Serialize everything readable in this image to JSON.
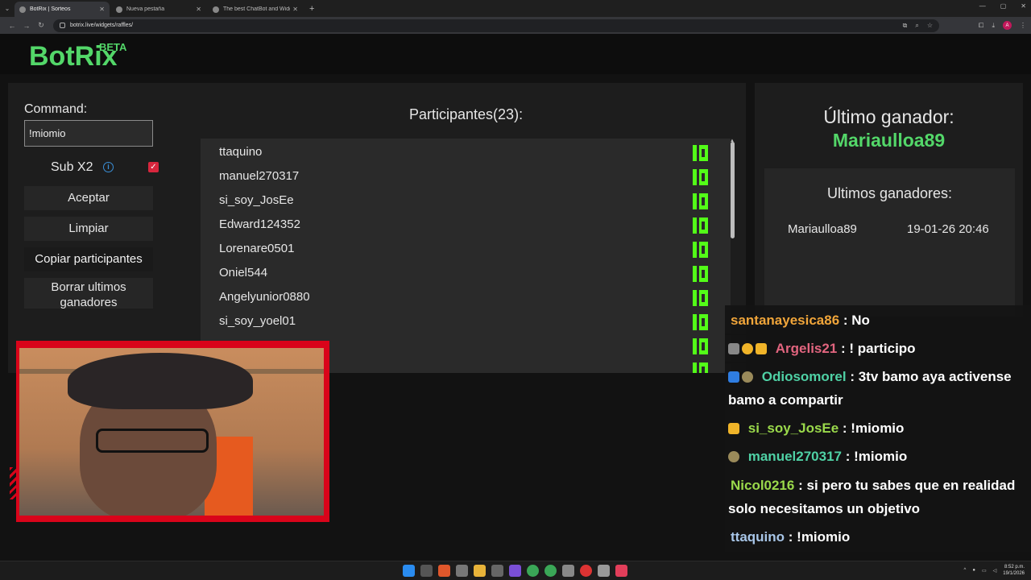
{
  "browser": {
    "tabs": [
      {
        "title": "BotRix | Sorteos",
        "active": true
      },
      {
        "title": "Nueva pestaña",
        "active": false
      },
      {
        "title": "The best ChatBot and Widgets",
        "active": false
      }
    ],
    "new_tab": "+",
    "url": "botrix.live/widgets/raffles/",
    "profile_initial": "A"
  },
  "header": {
    "logo": "BotRix",
    "badge": "BETA"
  },
  "controls": {
    "command_label": "Command:",
    "command_value": "!miomio",
    "sub_label": "Sub X2",
    "info_icon": "i",
    "sub_checked": "✓",
    "accept": "Aceptar",
    "clear": "Limpiar",
    "copy": "Copiar participantes",
    "delete": "Borrar ultimos ganadores"
  },
  "participants": {
    "title": "Participantes(23):",
    "list": [
      "ttaquino",
      "manuel270317",
      "si_soy_JosEe",
      "Edward124352",
      "Lorenare0501",
      "Oniel544",
      "Angelyunior0880",
      "si_soy_yoel01"
    ]
  },
  "winners": {
    "last_title": "Último ganador:",
    "last_name": "Mariaulloa89",
    "recent_title": "Ultimos ganadores:",
    "recent": [
      {
        "name": "Mariaulloa89",
        "date": "19-01-26 20:46"
      }
    ]
  },
  "chat": [
    {
      "user": "santanayesica86",
      "color": "#f0a53a",
      "text": " : No"
    },
    {
      "user": "Argelis21",
      "color": "#e2657f",
      "text": " : ! participo"
    },
    {
      "user": "Odiosomorel",
      "color": "#4fd1a5",
      "text": " : 3tv bamo aya activense bamo a compartir"
    },
    {
      "user": "si_soy_JosEe",
      "color": "#9ad94b",
      "text": " : !miomio"
    },
    {
      "user": "manuel270317",
      "color": "#4fd1a5",
      "text": " : !miomio"
    },
    {
      "user": "Nicol0216",
      "color": "#9ad94b",
      "text": " : si pero tu sabes que en realidad solo necesitamos un objetivo"
    },
    {
      "user": "ttaquino",
      "color": "#a8c6e8",
      "text": " : !miomio"
    }
  ],
  "taskbar": {
    "time": "8:52 p.m.",
    "date": "19/1/2026"
  }
}
